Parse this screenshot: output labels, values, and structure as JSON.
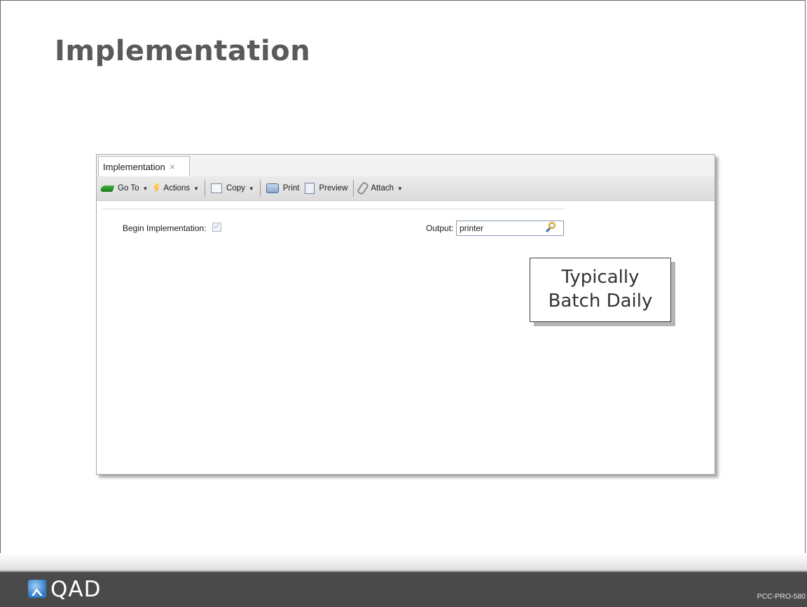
{
  "slide": {
    "title": "Implementation",
    "code": "PCC-PRO-580"
  },
  "window": {
    "tab": {
      "label": "Implementation",
      "close_glyph": "×"
    },
    "toolbar": {
      "goto": "Go To",
      "actions": "Actions",
      "copy": "Copy",
      "print": "Print",
      "preview": "Preview",
      "attach": "Attach",
      "dropdown_glyph": "▼"
    },
    "form": {
      "begin_label": "Begin Implementation:",
      "begin_checked": true,
      "check_glyph": "✓",
      "output_label": "Output:",
      "output_value": "printer"
    }
  },
  "callout": {
    "line1": "Typically",
    "line2": "Batch Daily"
  },
  "footer": {
    "logo_text": "QAD"
  },
  "icons": {
    "goto": "goto-arrow-icon",
    "actions": "lightning-icon",
    "copy": "copy-icon",
    "print": "printer-icon",
    "preview": "preview-icon",
    "attach": "paperclip-icon",
    "lookup": "magnifier-icon",
    "logo": "qad-logo-icon"
  },
  "colors": {
    "title": "#5a5a5a",
    "footer_bg": "#4a4a4a",
    "goto_green": "#2e9a2e",
    "actions_yellow": "#f2a21b"
  }
}
